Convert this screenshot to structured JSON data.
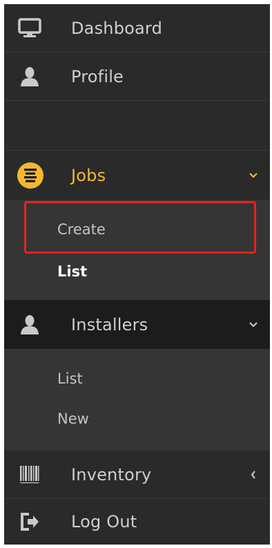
{
  "nav": {
    "dashboard": {
      "label": "Dashboard",
      "icon": "monitor-icon"
    },
    "profile": {
      "label": "Profile",
      "icon": "user-icon"
    },
    "jobs": {
      "label": "Jobs",
      "icon": "list-icon",
      "expanded": true,
      "children": [
        "Create",
        "List"
      ]
    },
    "installers": {
      "label": "Installers",
      "icon": "user-icon",
      "expanded": true,
      "children": [
        "List",
        "New"
      ]
    },
    "inventory": {
      "label": "Inventory",
      "icon": "barcode-icon",
      "expanded": false
    },
    "logout": {
      "label": "Log Out",
      "icon": "sign-out-icon"
    }
  },
  "colors": {
    "sidebar_bg": "#2a2a2a",
    "active_bg": "#1c1c1c",
    "submenu_bg": "#353535",
    "accent": "#f5b82e",
    "highlight": "#e8231f"
  }
}
